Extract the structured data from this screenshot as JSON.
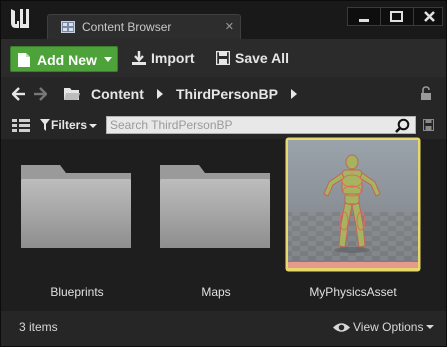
{
  "window": {
    "tab_title": "Content Browser",
    "tab_icon": "content-browser-icon",
    "app_icon": "unreal-engine-logo",
    "controls": [
      "minimize-icon",
      "maximize-icon",
      "close-icon"
    ]
  },
  "toolbar": {
    "add_new_label": "Add New",
    "import_label": "Import",
    "save_all_label": "Save All",
    "accent_color": "#4da33a"
  },
  "path": {
    "crumbs": [
      "Content",
      "ThirdPersonBP"
    ]
  },
  "filter": {
    "filters_label": "Filters",
    "search_placeholder": "Search ThirdPersonBP"
  },
  "assets": [
    {
      "name": "Blueprints",
      "type": "folder"
    },
    {
      "name": "Maps",
      "type": "folder"
    },
    {
      "name": "MyPhysicsAsset",
      "type": "physics-asset",
      "selected": true
    }
  ],
  "status": {
    "item_count": "3 items",
    "view_options_label": "View Options"
  }
}
